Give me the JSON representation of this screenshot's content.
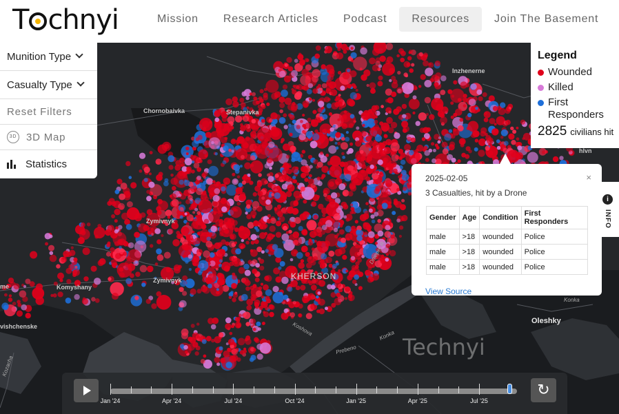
{
  "header": {
    "logo": "Technyi",
    "nav": [
      "Mission",
      "Research Articles",
      "Podcast",
      "Resources",
      "Join The Basement"
    ],
    "active_nav": "Resources"
  },
  "filters": {
    "munition_type": "Munition Type",
    "casualty_type": "Casualty Type",
    "reset": "Reset Filters",
    "map3d_badge": "3D",
    "map3d": "3D Map",
    "statistics": "Statistics"
  },
  "legend": {
    "title": "Legend",
    "items": [
      {
        "label": "Wounded",
        "color": "#e0001b"
      },
      {
        "label": "Killed",
        "color": "#d77ad8"
      },
      {
        "label": "First Responders",
        "color": "#1e6fd9"
      }
    ],
    "count_value": "2825",
    "count_text": "civilians hit"
  },
  "info_tab": {
    "label": "INFO",
    "icon": "info-icon"
  },
  "popup": {
    "date": "2025-02-05",
    "summary": "3 Casualties, hit by a Drone",
    "close": "×",
    "columns": [
      "Gender",
      "Age",
      "Condition",
      "First Responders"
    ],
    "rows": [
      [
        "male",
        ">18",
        "wounded",
        "Police"
      ],
      [
        "male",
        ">18",
        "wounded",
        "Police"
      ],
      [
        "male",
        ">18",
        "wounded",
        "Police"
      ]
    ],
    "link": "View Source"
  },
  "map_labels": [
    "Chornobaivka",
    "Stepanivka",
    "Inzhenerne",
    "Zymivnyk",
    "Zymivnyk",
    "Komyshany",
    "vishchenske",
    "KHERSON",
    "Kozacha",
    "Prebeno",
    "Konka",
    "Konka",
    "Oleshky",
    "Dnieper R.",
    "Koshova",
    "me",
    "hlvn"
  ],
  "watermark": "Technyi",
  "timeline": {
    "labels": [
      "Jan '24",
      "Apr '24",
      "Jul '24",
      "Oct '24",
      "Jan '25",
      "Apr '25",
      "Jul '25"
    ],
    "progress": 0.99,
    "play_icon": "play-icon",
    "reset_icon": "refresh-icon"
  }
}
